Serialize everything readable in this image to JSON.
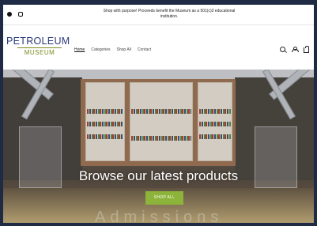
{
  "announcement": {
    "text": "Shop with purpose! Proceeds benefit the Museum as a 501(c)3 educational institution."
  },
  "social": {
    "icons": [
      "facebook-icon",
      "instagram-icon"
    ]
  },
  "logo": {
    "top": "PETROLEUM",
    "bottom": "MUSEUM"
  },
  "nav": {
    "items": [
      {
        "label": "Home",
        "active": true
      },
      {
        "label": "Categories",
        "active": false
      },
      {
        "label": "Shop All",
        "active": false
      },
      {
        "label": "Contact",
        "active": false
      }
    ]
  },
  "header_icons": [
    "search-icon",
    "account-icon",
    "cart-icon"
  ],
  "hero": {
    "title": "Browse our latest products",
    "button_label": "SHOP ALL",
    "background_text": "Admissions"
  },
  "colors": {
    "page_bg": "#1f2a44",
    "logo_blue": "#2a3a7a",
    "logo_olive": "#7a8a20",
    "button_green": "#8db43a"
  }
}
